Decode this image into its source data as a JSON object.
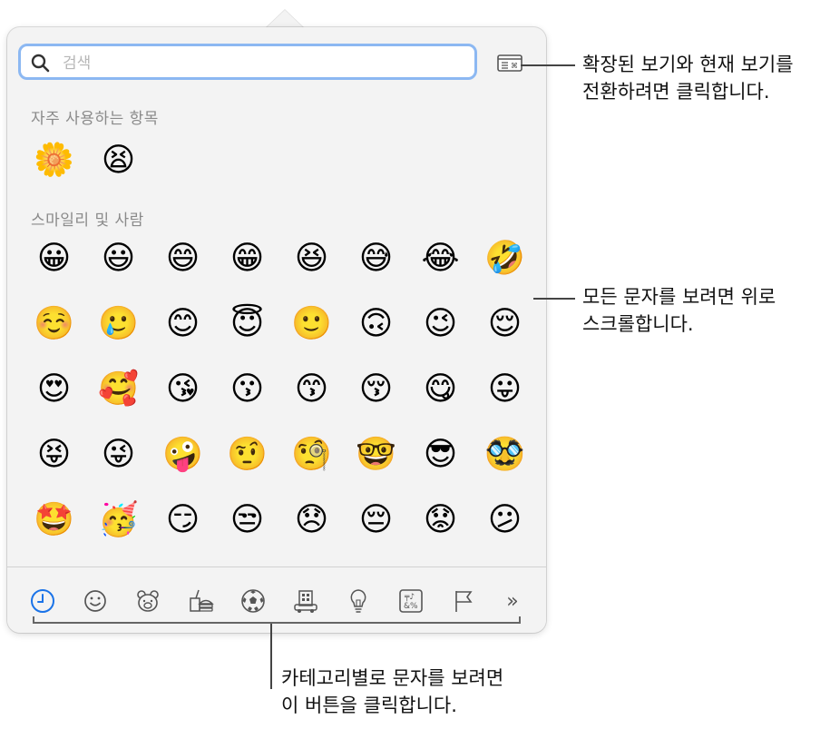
{
  "search": {
    "placeholder": "검색",
    "value": ""
  },
  "sections": {
    "frequent": {
      "title": "자주 사용하는 항목",
      "emojis": [
        "🌼",
        "😫"
      ]
    },
    "smileys": {
      "title": "스마일리 및 사람",
      "rows": [
        [
          "😀",
          "😃",
          "😄",
          "😁",
          "😆",
          "😅",
          "😂",
          "🤣"
        ],
        [
          "☺️",
          "🥲",
          "😊",
          "😇",
          "🙂",
          "🙃",
          "😉",
          "😌"
        ],
        [
          "😍",
          "🥰",
          "😘",
          "😗",
          "😙",
          "😚",
          "😋",
          "😛"
        ],
        [
          "😝",
          "😜",
          "🤪",
          "🤨",
          "🧐",
          "🤓",
          "😎",
          "🥸"
        ],
        [
          "🤩",
          "🥳",
          "😏",
          "😒",
          "😞",
          "😔",
          "😟",
          "😕"
        ],
        [
          "🙁",
          "☹️",
          "😣",
          "😖",
          "😫",
          "😩",
          "🥺",
          "😢"
        ]
      ]
    }
  },
  "tabs": [
    {
      "icon": "clock-icon",
      "label": "recent"
    },
    {
      "icon": "smiley-icon",
      "label": "smileys"
    },
    {
      "icon": "bear-icon",
      "label": "animals"
    },
    {
      "icon": "food-icon",
      "label": "food"
    },
    {
      "icon": "ball-icon",
      "label": "activity"
    },
    {
      "icon": "building-icon",
      "label": "travel"
    },
    {
      "icon": "bulb-icon",
      "label": "objects"
    },
    {
      "icon": "symbols-icon",
      "label": "symbols"
    },
    {
      "icon": "flag-icon",
      "label": "flags"
    },
    {
      "icon": "more-icon",
      "label": "more"
    }
  ],
  "symbols_tab_glyph": "╤♪&%",
  "more_glyph": "»",
  "callouts": {
    "view_toggle": [
      "확장된 보기와 현재 보기를",
      "전환하려면 클릭합니다."
    ],
    "scroll": [
      "모든 문자를 보려면 위로",
      "스크롤합니다."
    ],
    "categories": [
      "카테고리별로 문자를 보려면",
      "이 버튼을 클릭합니다."
    ]
  },
  "colors": {
    "accent": "#1a73e8",
    "search_border": "#8cb8f2",
    "panel": "#f3f3f3"
  }
}
